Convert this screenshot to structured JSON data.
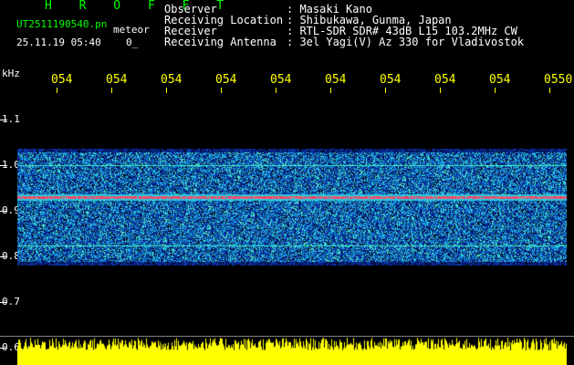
{
  "header": {
    "app_name": "H R O F F T",
    "file_name": "UT2511190540.pn",
    "meter_label": "meteor",
    "timestamp": "25.11.19 05:40",
    "count": "0_"
  },
  "info": [
    {
      "key": "Observer",
      "value": ": Masaki Kano"
    },
    {
      "key": "Receiving Location",
      "value": ": Shibukawa, Gunma, Japan"
    },
    {
      "key": "Receiver",
      "value": ": RTL-SDR SDR# 43dB L15 103.2MHz CW"
    },
    {
      "key": "Receiving Antenna",
      "value": ": 3el Yagi(V) Az 330 for Vladivostok"
    }
  ],
  "axis": {
    "unit": "kHz",
    "time_ticks": [
      "054",
      "054",
      "054",
      "054",
      "054",
      "054",
      "054",
      "054",
      "054",
      "0550"
    ],
    "freq_labels": [
      "1.1",
      "1.0",
      "0.9",
      "0.8",
      "0.7",
      "0.6"
    ]
  },
  "colors": {
    "header_green": "#00ff00",
    "text_white": "#ffffff",
    "tick_yellow": "#ffff00",
    "signal_red": "#ff2060",
    "noise_blue": "#1030c0"
  }
}
